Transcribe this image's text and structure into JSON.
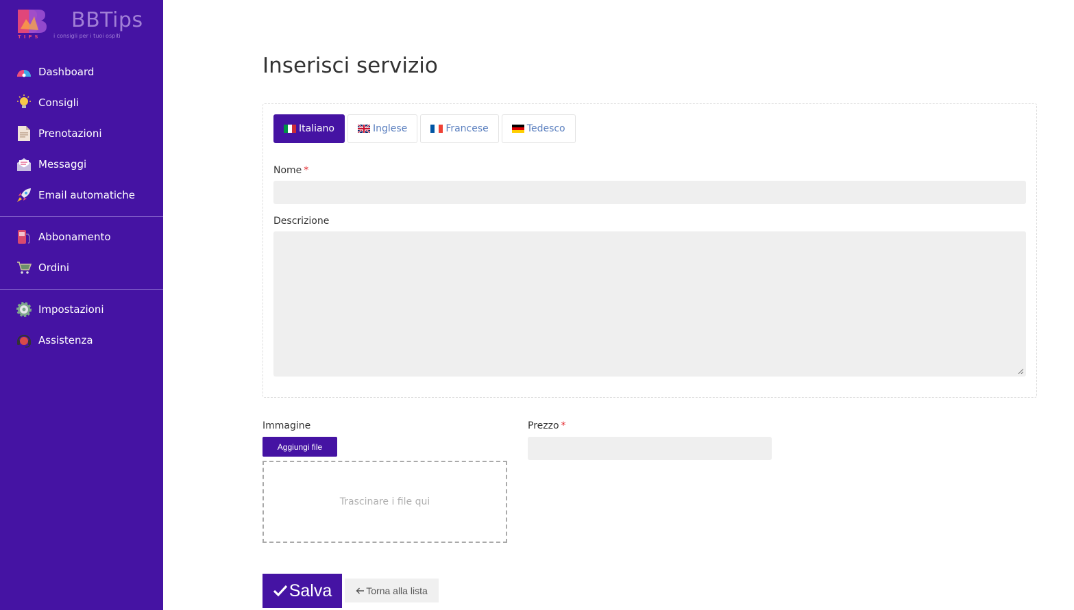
{
  "brand": {
    "name": "BBTips",
    "tagline": "i consigli per i tuoi ospiti",
    "tips_text": "TIPS"
  },
  "sidebar": {
    "group1": [
      {
        "label": "Dashboard",
        "icon": "gauge-icon"
      },
      {
        "label": "Consigli",
        "icon": "lightbulb-icon"
      },
      {
        "label": "Prenotazioni",
        "icon": "document-icon"
      },
      {
        "label": "Messaggi",
        "icon": "envelope-icon"
      },
      {
        "label": "Email automatiche",
        "icon": "rocket-icon"
      }
    ],
    "group2": [
      {
        "label": "Abbonamento",
        "icon": "gas-pump-icon"
      },
      {
        "label": "Ordini",
        "icon": "cart-icon"
      }
    ],
    "group3": [
      {
        "label": "Impostazioni",
        "icon": "gear-icon"
      },
      {
        "label": "Assistenza",
        "icon": "headset-icon"
      }
    ]
  },
  "page": {
    "title": "Inserisci servizio"
  },
  "tabs": [
    {
      "label": "Italiano",
      "flag": "it-flag-icon",
      "active": true
    },
    {
      "label": "Inglese",
      "flag": "uk-flag-icon",
      "active": false
    },
    {
      "label": "Francese",
      "flag": "fr-flag-icon",
      "active": false
    },
    {
      "label": "Tedesco",
      "flag": "de-flag-icon",
      "active": false
    }
  ],
  "form": {
    "nome_label": "Nome",
    "nome_value": "",
    "descrizione_label": "Descrizione",
    "descrizione_value": "",
    "immagine_label": "Immagine",
    "add_file_label": "Aggiungi file",
    "dropzone_text": "Trascinare i file qui",
    "prezzo_label": "Prezzo",
    "prezzo_value": "",
    "required_mark": "*"
  },
  "actions": {
    "save_label": "Salva",
    "back_label": "Torna alla lista"
  },
  "colors": {
    "primary": "#4513a3",
    "required": "#e3262b",
    "input_bg": "#efefef"
  }
}
